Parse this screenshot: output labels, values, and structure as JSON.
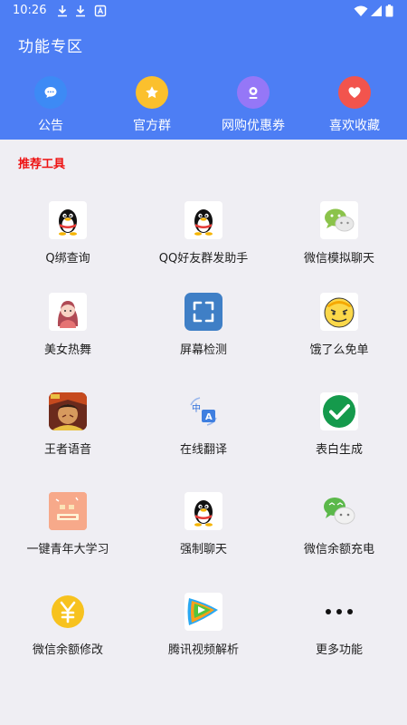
{
  "status_bar": {
    "time": "10:26",
    "left_icons": [
      "download-icon",
      "download-icon",
      "notification-icon"
    ],
    "right_icons": [
      "wifi-icon",
      "signal-icon",
      "battery-icon"
    ]
  },
  "header": {
    "title": "功能专区",
    "background": "#4d7ef4",
    "quick_actions": [
      {
        "label": "公告",
        "icon": "chat-bubble-icon",
        "color": "#3d8af5"
      },
      {
        "label": "官方群",
        "icon": "star-icon",
        "color": "#fbc02d"
      },
      {
        "label": "网购优惠券",
        "icon": "coupon-icon",
        "color": "#9577f7"
      },
      {
        "label": "喜欢收藏",
        "icon": "heart-icon",
        "color": "#f2544d"
      }
    ]
  },
  "section": {
    "title": "推荐工具",
    "title_color": "#ee1111"
  },
  "tools": [
    {
      "label": "Q绑查询",
      "icon": "qq-penguin-icon"
    },
    {
      "label": "QQ好友群发助手",
      "icon": "qq-penguin-icon"
    },
    {
      "label": "微信模拟聊天",
      "icon": "wechat-icon"
    },
    {
      "label": "美女热舞",
      "icon": "avatar-girl-icon"
    },
    {
      "label": "屏幕检测",
      "icon": "fullscreen-icon"
    },
    {
      "label": "饿了么免单",
      "icon": "meme-face-icon"
    },
    {
      "label": "王者语音",
      "icon": "game-hero-icon"
    },
    {
      "label": "在线翻译",
      "icon": "translate-icon"
    },
    {
      "label": "表白生成",
      "icon": "check-circle-icon"
    },
    {
      "label": "一键青年大学习",
      "icon": "study-card-icon"
    },
    {
      "label": "强制聊天",
      "icon": "qq-penguin-icon"
    },
    {
      "label": "微信余额充电",
      "icon": "wechat-icon"
    },
    {
      "label": "微信余额修改",
      "icon": "yuan-coin-icon"
    },
    {
      "label": "腾讯视频解析",
      "icon": "tencent-video-icon"
    },
    {
      "label": "更多功能",
      "icon": "more-dots-icon"
    }
  ]
}
